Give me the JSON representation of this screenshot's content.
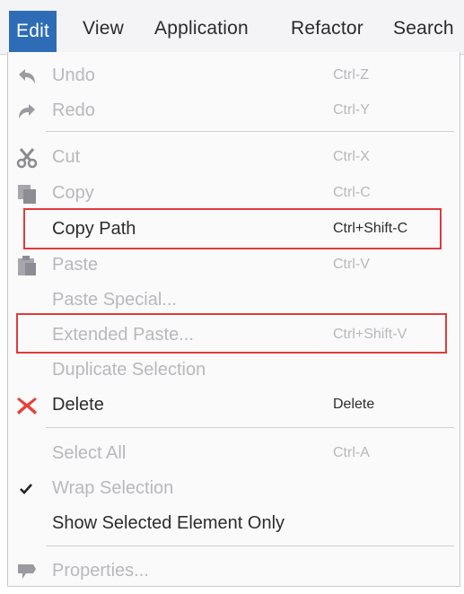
{
  "menubar": {
    "items": [
      {
        "label": "Edit"
      },
      {
        "label": "View"
      },
      {
        "label": "Application"
      },
      {
        "label": "Refactor"
      },
      {
        "label": "Search"
      }
    ]
  },
  "menu": {
    "items": [
      {
        "label": "Undo",
        "shortcut": "Ctrl-Z",
        "icon": "undo-icon",
        "enabled": false
      },
      {
        "label": "Redo",
        "shortcut": "Ctrl-Y",
        "icon": "redo-icon",
        "enabled": false
      },
      {
        "label": "Cut",
        "shortcut": "Ctrl-X",
        "icon": "cut-icon",
        "enabled": false
      },
      {
        "label": "Copy",
        "shortcut": "Ctrl-C",
        "icon": "copy-icon",
        "enabled": false
      },
      {
        "label": "Copy Path",
        "shortcut": "Ctrl+Shift-C",
        "icon": "",
        "enabled": true,
        "highlighted": true
      },
      {
        "label": "Paste",
        "shortcut": "Ctrl-V",
        "icon": "paste-icon",
        "enabled": false
      },
      {
        "label": "Paste Special...",
        "shortcut": "",
        "icon": "",
        "enabled": false
      },
      {
        "label": "Extended Paste...",
        "shortcut": "Ctrl+Shift-V",
        "icon": "",
        "enabled": false,
        "highlighted": true
      },
      {
        "label": "Duplicate Selection",
        "shortcut": "",
        "icon": "",
        "enabled": false
      },
      {
        "label": "Delete",
        "shortcut": "Delete",
        "icon": "delete-icon",
        "enabled": true
      },
      {
        "label": "Select All",
        "shortcut": "Ctrl-A",
        "icon": "",
        "enabled": false
      },
      {
        "label": "Wrap Selection",
        "shortcut": "",
        "icon": "check-icon",
        "enabled": false,
        "checked": true
      },
      {
        "label": "Show Selected Element Only",
        "shortcut": "",
        "icon": "",
        "enabled": true
      },
      {
        "label": "Properties...",
        "shortcut": "",
        "icon": "properties-icon",
        "enabled": false
      }
    ]
  },
  "colors": {
    "accent": "#2e6db6",
    "highlight_border": "#e03a3e",
    "disabled_text": "#b8b8bd",
    "delete_icon": "#e0453a"
  }
}
